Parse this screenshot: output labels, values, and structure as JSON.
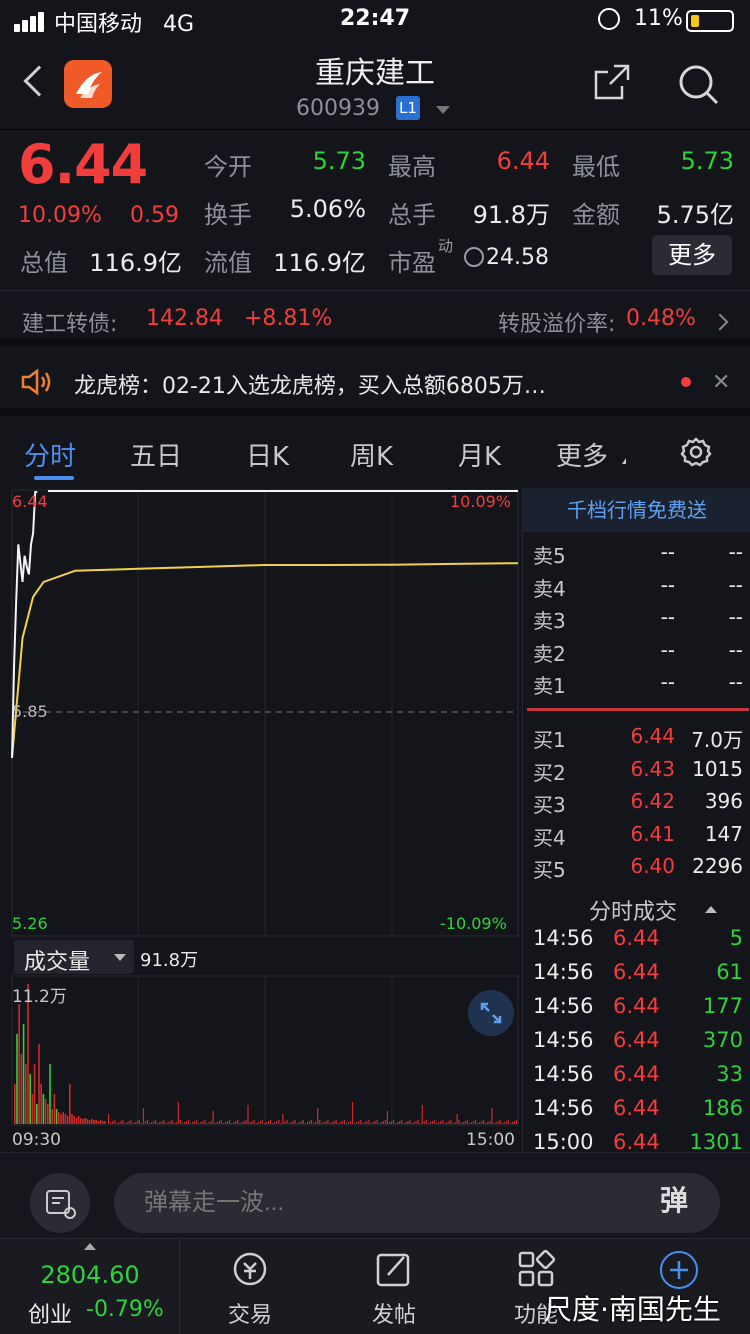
{
  "status": {
    "carrier": "中国移动",
    "network": "4G",
    "time": "22:47",
    "battery": "11%"
  },
  "nav": {
    "title": "重庆建工",
    "code": "600939",
    "level": "L1"
  },
  "quote": {
    "price": "6.44",
    "pct": "10.09%",
    "change": "0.59",
    "open_label": "今开",
    "open": "5.73",
    "high_label": "最高",
    "high": "6.44",
    "low_label": "最低",
    "low": "5.73",
    "turnover_label": "换手",
    "turnover": "5.06%",
    "volume_label": "总手",
    "volume": "91.8万",
    "amount_label": "金额",
    "amount": "5.75亿",
    "mcap_label": "总值",
    "mcap": "116.9亿",
    "float_label": "流值",
    "float": "116.9亿",
    "pe_label": "市盈",
    "pe_sup": "动",
    "pe": "24.58",
    "more": "更多"
  },
  "bond": {
    "label": "建工转债:",
    "price": "142.84",
    "change": "+8.81%",
    "premium_label": "转股溢价率:",
    "premium": "0.48%"
  },
  "news": {
    "text": "龙虎榜：02-21入选龙虎榜，买入总额6805万…"
  },
  "tabs": [
    "分时",
    "五日",
    "日K",
    "周K",
    "月K",
    "更多"
  ],
  "chart": {
    "top_price": "6.44",
    "top_pct": "10.09%",
    "mid_price": "5.85",
    "bottom_price": "5.26",
    "bottom_pct": "-10.09%",
    "volume_selector": "成交量",
    "volume_total": "91.8万",
    "volume_max": "11.2万",
    "time_start": "09:30",
    "time_end": "15:00"
  },
  "chart_data": {
    "type": "line",
    "series": [
      {
        "name": "price",
        "x": [
          "09:30",
          "09:31",
          "09:32",
          "09:33",
          "09:34",
          "09:35",
          "09:36",
          "09:37",
          "09:38",
          "09:39",
          "09:40",
          "09:41",
          "09:42"
        ],
        "values": [
          5.73,
          5.98,
          6.15,
          6.3,
          6.25,
          6.2,
          6.27,
          6.24,
          6.22,
          6.3,
          6.33,
          6.44,
          6.44
        ]
      },
      {
        "name": "avg",
        "x": [
          "09:30",
          "09:35",
          "09:40",
          "09:45",
          "10:00",
          "10:30",
          "11:00",
          "11:30",
          "13:30",
          "14:00",
          "14:30",
          "15:00"
        ],
        "values": [
          5.73,
          6.05,
          6.16,
          6.2,
          6.23,
          6.235,
          6.24,
          6.245,
          6.245,
          6.246,
          6.248,
          6.25
        ]
      }
    ],
    "ylim": [
      5.26,
      6.44
    ]
  },
  "book": {
    "promo": "千档行情免费送",
    "asks": [
      {
        "label": "卖5",
        "price": "--",
        "vol": "--"
      },
      {
        "label": "卖4",
        "price": "--",
        "vol": "--"
      },
      {
        "label": "卖3",
        "price": "--",
        "vol": "--"
      },
      {
        "label": "卖2",
        "price": "--",
        "vol": "--"
      },
      {
        "label": "卖1",
        "price": "--",
        "vol": "--"
      }
    ],
    "bids": [
      {
        "label": "买1",
        "price": "6.44",
        "vol": "7.0万"
      },
      {
        "label": "买2",
        "price": "6.43",
        "vol": "1015"
      },
      {
        "label": "买3",
        "price": "6.42",
        "vol": "396"
      },
      {
        "label": "买4",
        "price": "6.41",
        "vol": "147"
      },
      {
        "label": "买5",
        "price": "6.40",
        "vol": "2296"
      }
    ],
    "ticks_title": "分时成交",
    "ticks": [
      {
        "t": "14:56",
        "p": "6.44",
        "v": "5"
      },
      {
        "t": "14:56",
        "p": "6.44",
        "v": "61"
      },
      {
        "t": "14:56",
        "p": "6.44",
        "v": "177"
      },
      {
        "t": "14:56",
        "p": "6.44",
        "v": "370"
      },
      {
        "t": "14:56",
        "p": "6.44",
        "v": "33"
      },
      {
        "t": "14:56",
        "p": "6.44",
        "v": "186"
      },
      {
        "t": "15:00",
        "p": "6.44",
        "v": "1301"
      }
    ]
  },
  "comment": {
    "placeholder": "弹幕走一波...",
    "danmu_btn": "弹"
  },
  "tabbar": {
    "index_value": "2804.60",
    "index_name": "创业",
    "index_change": "-0.79%",
    "items": [
      "交易",
      "发帖",
      "功能"
    ]
  },
  "watermark": "尺度·南国先生",
  "colors": {
    "up": "#f23d3d",
    "down": "#2fd13c",
    "accent": "#4a8ff0"
  }
}
